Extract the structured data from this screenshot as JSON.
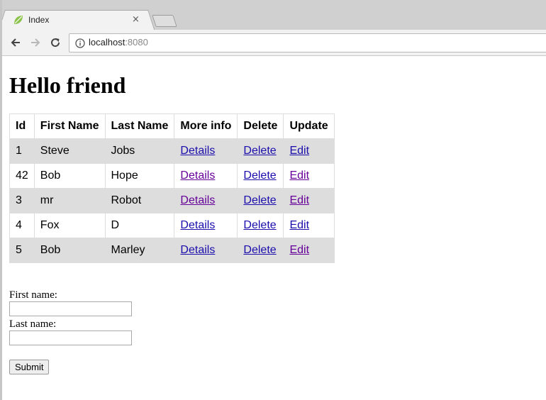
{
  "browser": {
    "tab_title": "Index",
    "close_glyph": "×",
    "url_host": "localhost",
    "url_port": ":8080"
  },
  "page": {
    "title": "Hello friend",
    "table": {
      "headers": [
        "Id",
        "First Name",
        "Last Name",
        "More info",
        "Delete",
        "Update"
      ],
      "rows": [
        {
          "id": "1",
          "first": "Steve",
          "last": "Jobs",
          "details": "Details",
          "delete": "Delete",
          "edit": "Edit"
        },
        {
          "id": "42",
          "first": "Bob",
          "last": "Hope",
          "details": "Details",
          "delete": "Delete",
          "edit": "Edit"
        },
        {
          "id": "3",
          "first": "mr",
          "last": "Robot",
          "details": "Details",
          "delete": "Delete",
          "edit": "Edit"
        },
        {
          "id": "4",
          "first": "Fox",
          "last": "D",
          "details": "Details",
          "delete": "Delete",
          "edit": "Edit"
        },
        {
          "id": "5",
          "first": "Bob",
          "last": "Marley",
          "details": "Details",
          "delete": "Delete",
          "edit": "Edit"
        }
      ]
    },
    "form": {
      "first_name_label": "First name:",
      "first_name_value": "",
      "last_name_label": "Last name:",
      "last_name_value": "",
      "submit_label": "Submit"
    }
  },
  "colors": {
    "link": "#1a0dab",
    "visited_link": "#660099",
    "row_stripe": "#dddddd"
  },
  "icons": {
    "tab_favicon": "spring-leaf-icon",
    "back": "back-arrow-icon",
    "forward": "forward-arrow-icon",
    "reload": "reload-icon",
    "site_info": "info-icon"
  }
}
